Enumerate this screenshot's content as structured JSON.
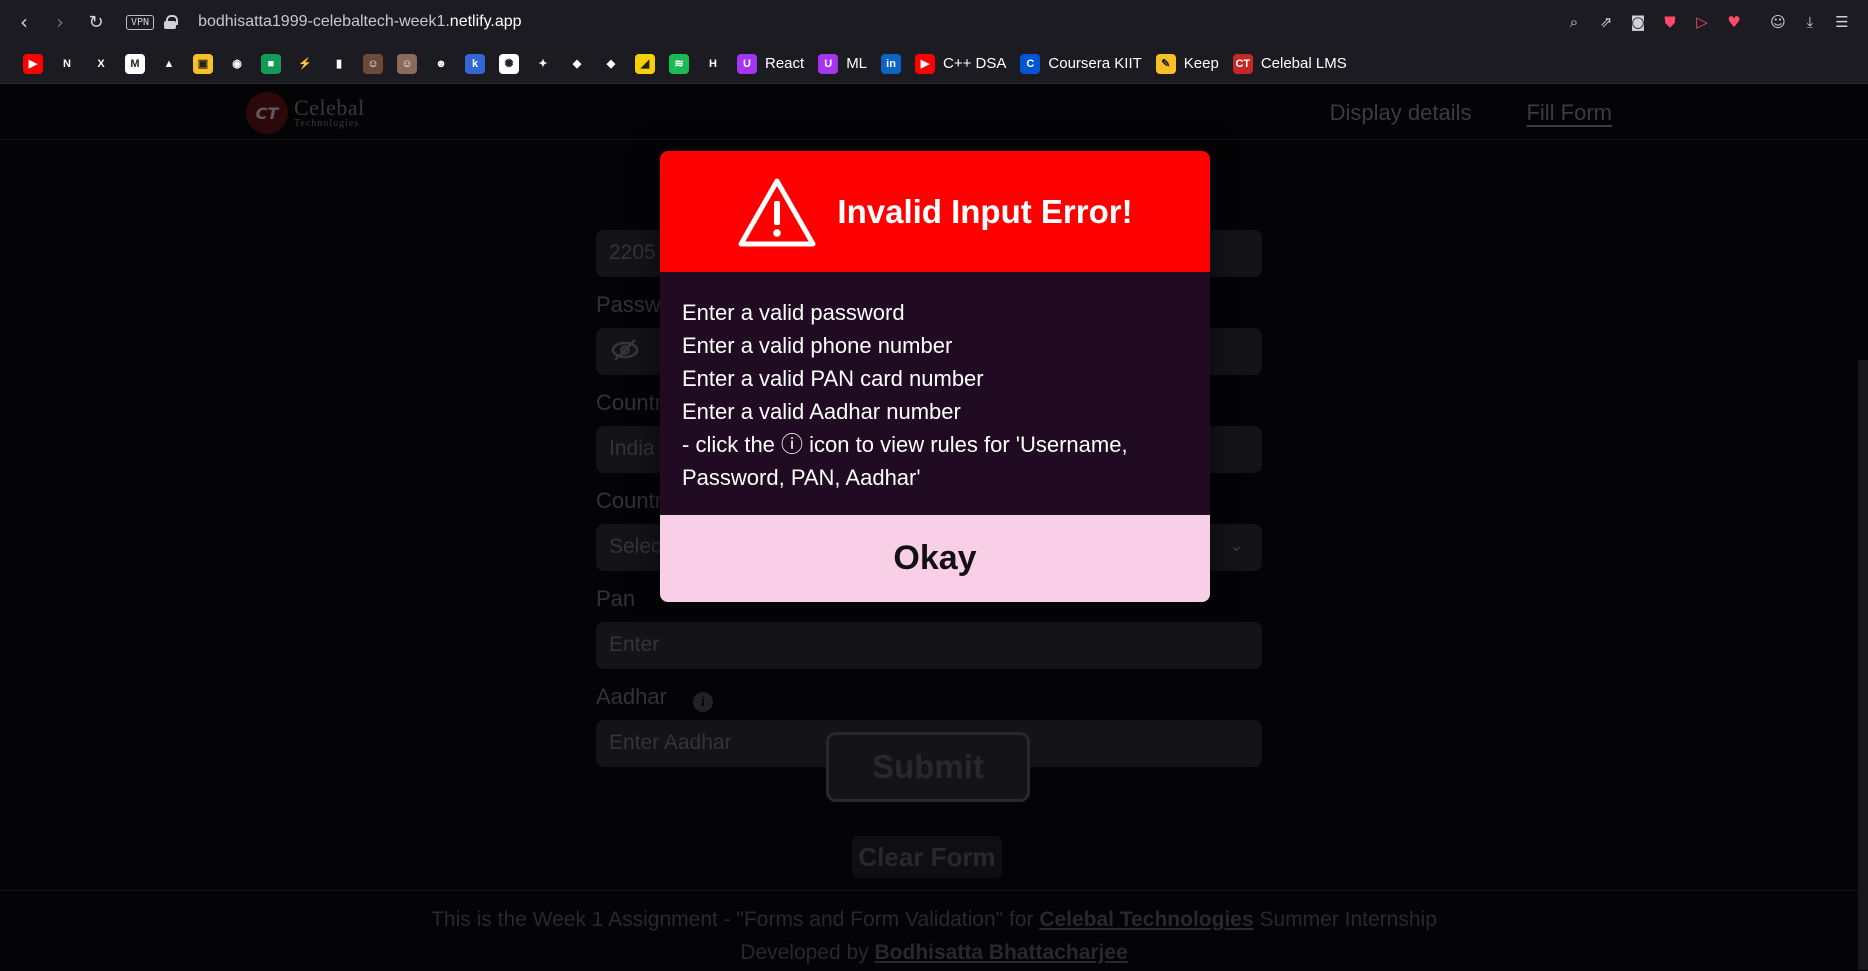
{
  "browser": {
    "vpn_label": "VPN",
    "url_prefix": "bodhisatta1999-celebaltech-week1.",
    "url_domain": "netlify.app"
  },
  "bookmarks": [
    {
      "icon": "youtube-icon",
      "color": "#ff0000",
      "glyph": "▶",
      "label": ""
    },
    {
      "icon": "netflix-icon",
      "color": "#1c1b22",
      "glyph": "N",
      "label": ""
    },
    {
      "icon": "x-icon",
      "color": "#1c1b22",
      "glyph": "X",
      "label": ""
    },
    {
      "icon": "gmail-icon",
      "color": "#ffffff",
      "glyph": "M",
      "label": ""
    },
    {
      "icon": "drive-icon",
      "color": "#1c1b22",
      "glyph": "▲",
      "label": ""
    },
    {
      "icon": "photos-icon",
      "color": "#f6c026",
      "glyph": "▣",
      "label": ""
    },
    {
      "icon": "github-icon",
      "color": "#1c1b22",
      "glyph": "◉",
      "label": ""
    },
    {
      "icon": "meet-icon",
      "color": "#0f9d58",
      "glyph": "■",
      "label": ""
    },
    {
      "icon": "bolt-icon",
      "color": "#1c1b22",
      "glyph": "⚡",
      "label": ""
    },
    {
      "icon": "chart-icon",
      "color": "#1c1b22",
      "glyph": "▮",
      "label": ""
    },
    {
      "icon": "avatar-one-icon",
      "color": "#6a4a3a",
      "glyph": "☺",
      "label": ""
    },
    {
      "icon": "avatar-two-icon",
      "color": "#8a6a5a",
      "glyph": "☺",
      "label": ""
    },
    {
      "icon": "smiley-icon",
      "color": "#1c1b22",
      "glyph": "☻",
      "label": ""
    },
    {
      "icon": "kite-icon",
      "color": "#3367d6",
      "glyph": "k",
      "label": ""
    },
    {
      "icon": "chatgpt-icon",
      "color": "#ffffff",
      "glyph": "✺",
      "label": ""
    },
    {
      "icon": "gemini-icon",
      "color": "#1c1b22",
      "glyph": "✦",
      "label": ""
    },
    {
      "icon": "unity-icon",
      "color": "#1c1b22",
      "glyph": "◆",
      "label": ""
    },
    {
      "icon": "unity-two-icon",
      "color": "#1c1b22",
      "glyph": "◆",
      "label": ""
    },
    {
      "icon": "sticky-icon",
      "color": "#f6d000",
      "glyph": "◢",
      "label": ""
    },
    {
      "icon": "spotify-icon",
      "color": "#1db954",
      "glyph": "≋",
      "label": ""
    },
    {
      "icon": "hackerrank-icon",
      "color": "#1c1b22",
      "glyph": "H",
      "label": ""
    },
    {
      "icon": "udemy-icon",
      "color": "#a435f0",
      "glyph": "U",
      "label": "React"
    },
    {
      "icon": "udemy-ml-icon",
      "color": "#a435f0",
      "glyph": "U",
      "label": "ML"
    },
    {
      "icon": "linkedin-icon",
      "color": "#0a66c2",
      "glyph": "in",
      "label": ""
    },
    {
      "icon": "youtube-dsa-icon",
      "color": "#ff0000",
      "glyph": "▶",
      "label": "C++ DSA"
    },
    {
      "icon": "coursera-icon",
      "color": "#0056d2",
      "glyph": "C",
      "label": "Coursera KIIT"
    },
    {
      "icon": "keep-icon",
      "color": "#f6c026",
      "glyph": "✎",
      "label": "Keep"
    },
    {
      "icon": "celebal-icon",
      "color": "#c62828",
      "glyph": "CT",
      "label": "Celebal LMS"
    }
  ],
  "site": {
    "logo_mark": "CT",
    "logo_name": "Celebal",
    "logo_sub": "Technologies",
    "nav": {
      "display": "Display details",
      "fill": "Fill Form"
    }
  },
  "form": {
    "id_value": "2205",
    "password_label": "Password",
    "country_input_label": "Country",
    "country_value": "India",
    "country_select_label": "Country",
    "country_select_placeholder": "Select",
    "pan_label": "Pan",
    "pan_placeholder": "Enter",
    "aadhar_label": "Aadhar",
    "aadhar_placeholder": "Enter Aadhar",
    "submit": "Submit",
    "clear": "Clear Form"
  },
  "footer": {
    "line1_pre": "This is the Week 1 Assignment - \"Forms and Form Validation\" for ",
    "line1_link": "Celebal Technologies",
    "line1_post": " Summer Internship",
    "line2_pre": "Developed by ",
    "line2_link": "Bodhisatta Bhattacharjee"
  },
  "modal": {
    "title": "Invalid Input Error!",
    "lines": [
      "Enter a valid password",
      "Enter a valid phone number",
      "Enter a valid PAN card number",
      "Enter a valid Aadhar number",
      "- click the ⓘ icon to view rules for 'Username, Password, PAN, Aadhar'"
    ],
    "ok": "Okay"
  },
  "colors": {
    "modal_header": "#ff0000",
    "modal_body": "#200b22",
    "modal_footer": "#f9cee7"
  }
}
